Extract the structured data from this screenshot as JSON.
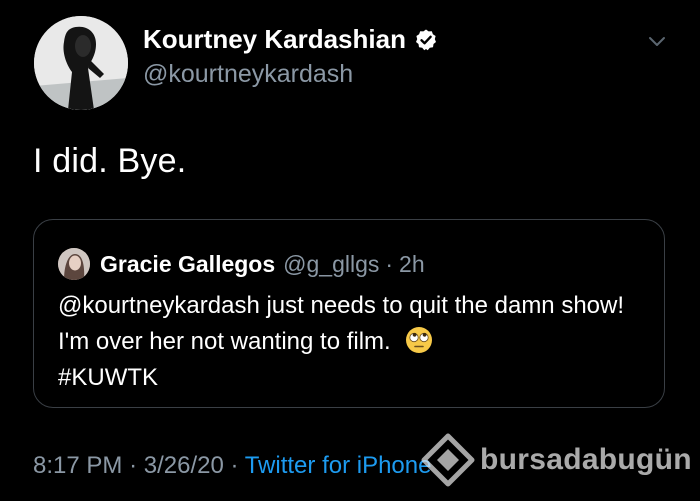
{
  "author": {
    "display_name": "Kourtney Kardashian",
    "handle": "@kourtneykardash",
    "verified_icon": "verified-badge-icon"
  },
  "tweet": {
    "text": "I did. Bye.",
    "time": "8:17 PM",
    "separator": "·",
    "date": "3/26/20",
    "source": "Twitter for iPhone"
  },
  "quoted_tweet": {
    "display_name": "Gracie Gallegos",
    "handle": "@g_gllgs",
    "separator": "·",
    "time": "2h",
    "text": "@kourtneykardash just needs to quit the damn show! I'm over her not wanting to film.",
    "emoji": "face-with-rolling-eyes",
    "hashtag": "#KUWTK"
  },
  "watermark": {
    "text": "bursadabugün"
  },
  "colors": {
    "background": "#000000",
    "primary_text": "#ffffff",
    "secondary_text": "#8b98a5",
    "link": "#1d9bf0",
    "border": "#3a3f45"
  }
}
